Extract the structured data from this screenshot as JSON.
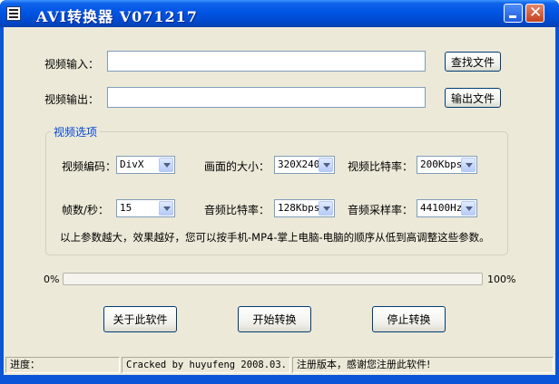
{
  "window": {
    "title": "AVI转换器 V071217"
  },
  "input": {
    "label": "视频输入：",
    "value": "",
    "browse_label": "查找文件"
  },
  "output": {
    "label": "视频输出：",
    "value": "",
    "browse_label": "输出文件"
  },
  "options": {
    "group_title": "视频选项",
    "video_codec": {
      "label": "视频编码：",
      "value": "DivX"
    },
    "frame_size": {
      "label": "画面的大小：",
      "value": "320X240"
    },
    "video_bitrate": {
      "label": "视频比特率：",
      "value": "200Kbps"
    },
    "fps": {
      "label": "帧数/秒：",
      "value": "15"
    },
    "audio_bitrate": {
      "label": "音频比特率：",
      "value": "128Kbps"
    },
    "audio_samplerate": {
      "label": "音频采样率：",
      "value": "44100Hz"
    },
    "hint": "以上参数越大，效果越好，您可以按手机-MP4-掌上电脑-电脑的顺序从低到高调整这些参数。"
  },
  "progress": {
    "min_label": "0%",
    "max_label": "100%",
    "value": 0
  },
  "buttons": {
    "about": "关于此软件",
    "start": "开始转换",
    "stop": "停止转换"
  },
  "status": {
    "progress_label": "进度：",
    "credit": "Cracked by huyufeng 2008.03.",
    "registration": "注册版本，感谢您注册此软件!"
  },
  "colors": {
    "titlebar": "#0054e3",
    "client": "#ece9d8",
    "group_title": "#0046d5"
  }
}
